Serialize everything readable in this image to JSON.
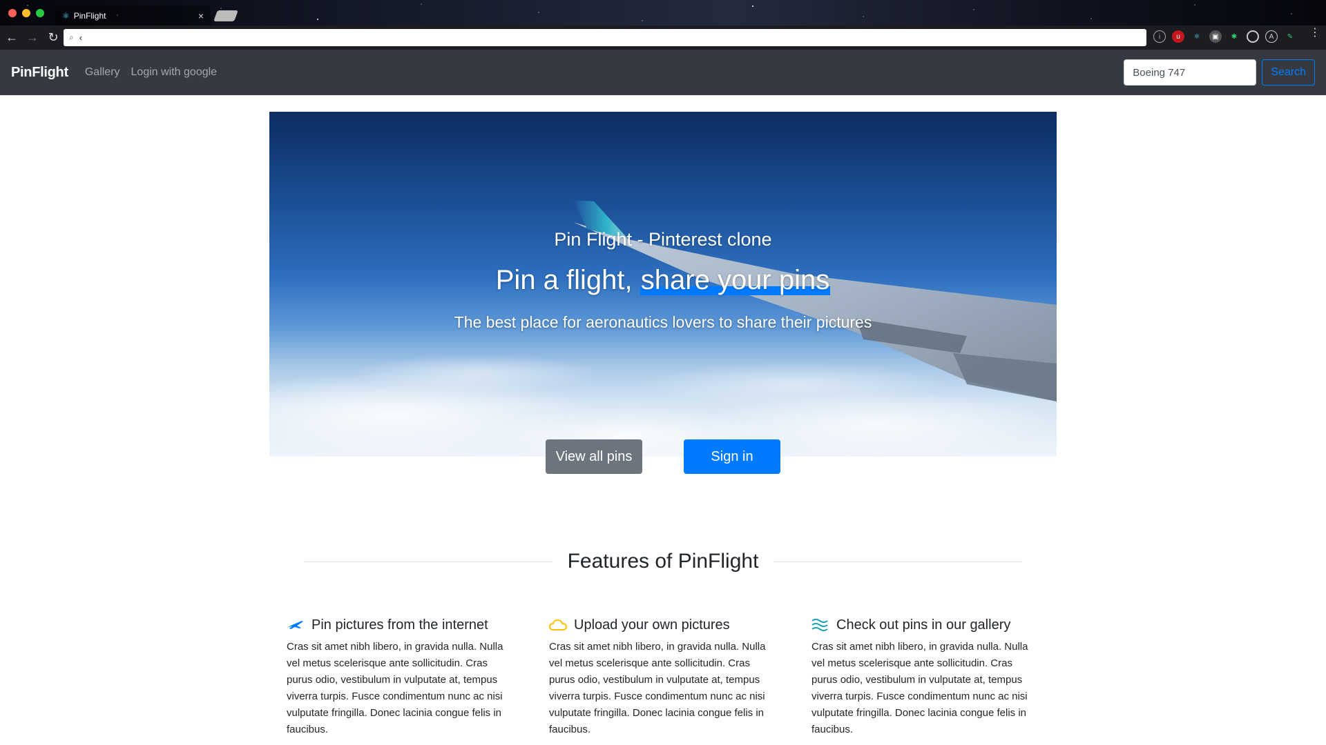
{
  "browser": {
    "tab_title": "PinFlight",
    "tab_close": "×",
    "address_text": "‹"
  },
  "navbar": {
    "brand": "PinFlight",
    "links": [
      "Gallery",
      "Login with google"
    ],
    "search_value": "Boeing 747",
    "search_button": "Search"
  },
  "hero": {
    "kicker": "Pin Flight - Pinterest clone",
    "title_plain": "Pin a flight, ",
    "title_highlight": "share your pins",
    "subtitle": "The best place for aeronautics lovers to share their pictures",
    "btn_view_all": "View all pins",
    "btn_sign_in": "Sign in"
  },
  "features": {
    "heading": "Features of PinFlight",
    "items": [
      {
        "title": "Pin pictures from the internet",
        "icon": "airplane-icon",
        "icon_color": "#007bff",
        "body": "Cras sit amet nibh libero, in gravida nulla. Nulla vel metus scelerisque ante sollicitudin. Cras purus odio, vestibulum in vulputate at, tempus viverra turpis. Fusce condimentum nunc ac nisi vulputate fringilla. Donec lacinia congue felis in faucibus."
      },
      {
        "title": "Upload your own pictures",
        "icon": "cloud-icon",
        "icon_color": "#ffc107",
        "body": "Cras sit amet nibh libero, in gravida nulla. Nulla vel metus scelerisque ante sollicitudin. Cras purus odio, vestibulum in vulputate at, tempus viverra turpis. Fusce condimentum nunc ac nisi vulputate fringilla. Donec lacinia congue felis in faucibus."
      },
      {
        "title": "Check out pins in our gallery",
        "icon": "waves-icon",
        "icon_color": "#17a2b8",
        "body": "Cras sit amet nibh libero, in gravida nulla. Nulla vel metus scelerisque ante sollicitudin. Cras purus odio, vestibulum in vulputate at, tempus viverra turpis. Fusce condimentum nunc ac nisi vulputate fringilla. Donec lacinia congue felis in faucibus."
      }
    ]
  },
  "colors": {
    "navbar_bg": "#343a40",
    "primary": "#007bff",
    "secondary": "#6c757d"
  }
}
